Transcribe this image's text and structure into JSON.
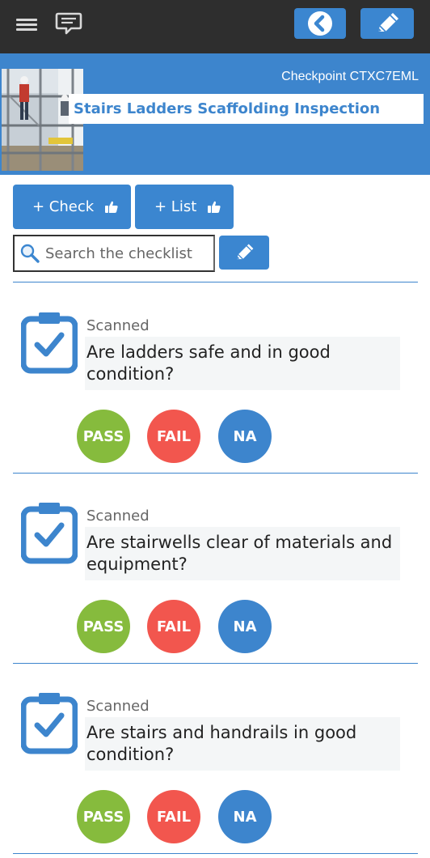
{
  "header": {
    "checkpoint": "Checkpoint CTXC7EML",
    "title": "Stairs Ladders Scaffolding Inspection"
  },
  "actions": {
    "check_label": "+ Check",
    "list_label": "+ List"
  },
  "search": {
    "placeholder": "Search the checklist"
  },
  "checklist": {
    "items": [
      {
        "status": "Scanned",
        "question": "Are ladders safe and in good condition?"
      },
      {
        "status": "Scanned",
        "question": "Are stairwells clear of materials and equipment?"
      },
      {
        "status": "Scanned",
        "question": "Are stairs and handrails in good condition?"
      }
    ]
  },
  "answers": {
    "pass": "PASS",
    "fail": "FAIL",
    "na": "NA"
  },
  "icons": {
    "menu": "hamburger-menu-icon",
    "chat": "speech-bubble-icon",
    "back": "chevron-left-circle-icon",
    "edit": "pencil-icon",
    "thumb": "thumbs-up-icon",
    "search": "magnifier-icon",
    "clipboard": "clipboard-check-icon"
  },
  "colors": {
    "topbar": "#2e2e2e",
    "accent": "#3d85cd",
    "pass": "#86bb3d",
    "fail": "#f2564e",
    "na": "#3d85cd"
  }
}
